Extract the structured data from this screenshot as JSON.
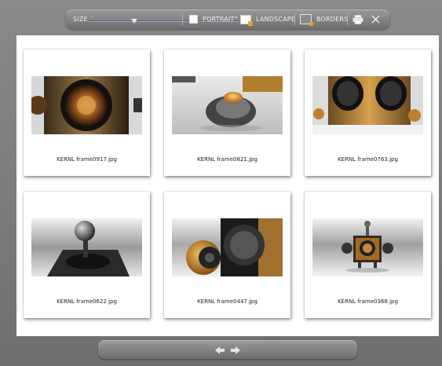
{
  "toolbar": {
    "size_label": "SIZE",
    "size_min": "-",
    "size_max": "+",
    "size_value_percent": 30,
    "portrait_label": "PORTRAIT",
    "landscape_label": "LANDSCAPE",
    "borders_label": "BORDERS"
  },
  "images": [
    {
      "caption": "KERNL frame0917.jpg"
    },
    {
      "caption": "KERNL frame0821.jpg"
    },
    {
      "caption": "KERNL frame0763.jpg"
    },
    {
      "caption": "KERNL frame0622.jpg"
    },
    {
      "caption": "KERNL frame0447.jpg"
    },
    {
      "caption": "KERNL frame0368.jpg"
    }
  ],
  "colors": {
    "accent": "#e0a030",
    "slider_track": "#4a6aa8"
  }
}
